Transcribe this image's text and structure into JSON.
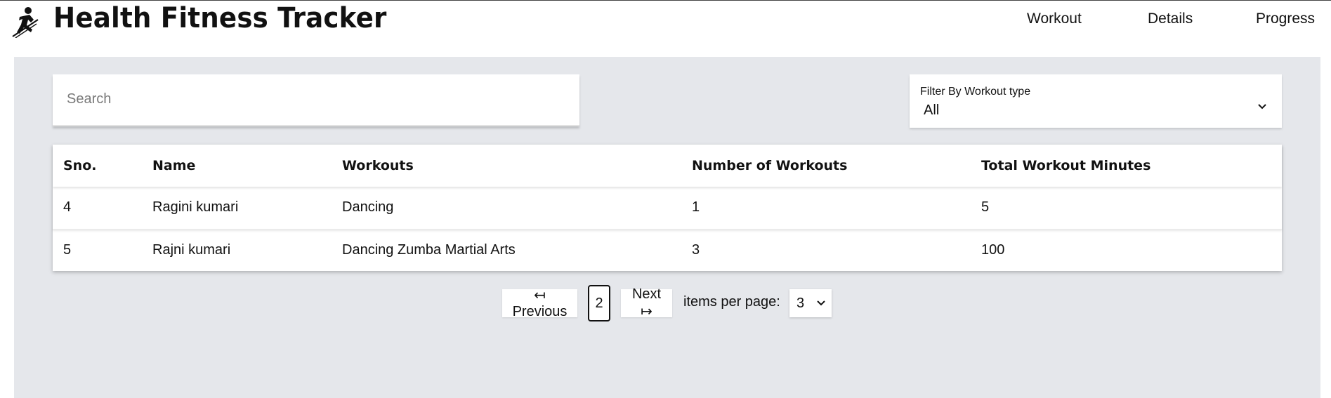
{
  "header": {
    "title": "Health Fitness Tracker",
    "nav": [
      "Workout",
      "Details",
      "Progress"
    ]
  },
  "search": {
    "placeholder": "Search",
    "value": ""
  },
  "filter": {
    "label": "Filter By Workout type",
    "selected": "All"
  },
  "table": {
    "columns": [
      "Sno.",
      "Name",
      "Workouts",
      "Number of Workouts",
      "Total Workout Minutes"
    ],
    "rows": [
      [
        "4",
        "Ragini kumari",
        "Dancing",
        "1",
        "5"
      ],
      [
        "5",
        "Rajni kumari",
        "Dancing Zumba Martial Arts",
        "3",
        "100"
      ]
    ]
  },
  "pagination": {
    "previous_label": "↤ Previous",
    "current_page": "2",
    "next_label": "Next ↦",
    "items_per_page_label": "items per page:",
    "items_per_page_value": "3"
  },
  "colors": {
    "content_background": "#e5e7eb",
    "panel_background": "#ffffff",
    "text": "#111111"
  },
  "icons": {
    "logo": "fitness-runner-icon",
    "filter_dropdown": "chevron-down-icon",
    "items_per_page_dropdown": "chevron-down-icon"
  }
}
